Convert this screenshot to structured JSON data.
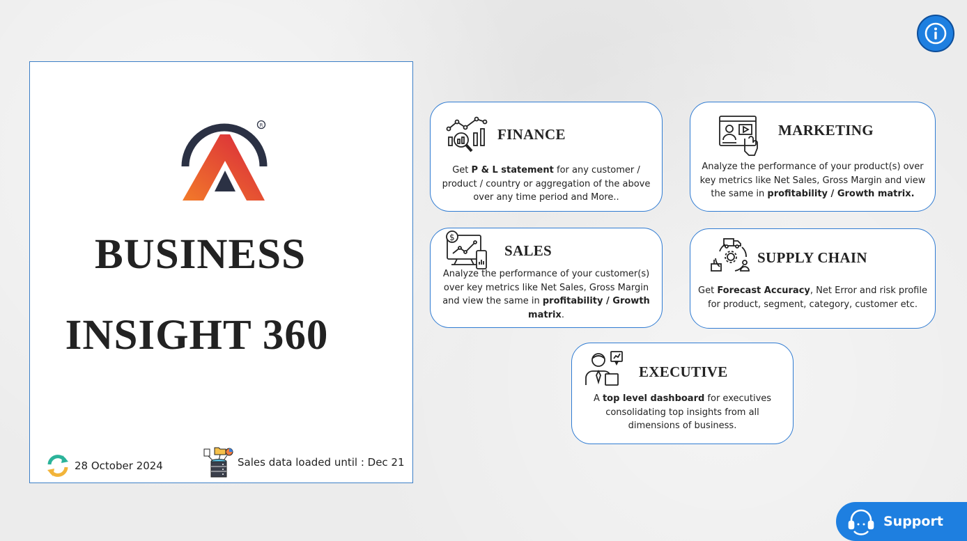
{
  "title_card": {
    "title_line1": "BUSINESS",
    "title_line2": "INSIGHT 360",
    "refresh_date": "28 October 2024",
    "data_loaded": "Sales data loaded until : Dec 21",
    "logo_icon": "brand-a-logo"
  },
  "cards": {
    "finance": {
      "title": "FINANCE",
      "icon": "finance-analytics-icon",
      "desc_pre": "Get ",
      "desc_bold1": "P & L statement",
      "desc_mid": " for any customer / product / country or aggregation of the above over any time period and More..",
      "desc_bold2": "",
      "desc_post": ""
    },
    "marketing": {
      "title": "MARKETING",
      "icon": "marketing-presentation-icon",
      "desc_pre": "Analyze the performance of your product(s) over key metrics like Net Sales, Gross Margin and view the same in ",
      "desc_bold1": "profitability / Growth matrix.",
      "desc_mid": "",
      "desc_bold2": "",
      "desc_post": ""
    },
    "sales": {
      "title": "SALES",
      "icon": "sales-dashboard-icon",
      "desc_pre": "Analyze the performance of your customer(s) over key metrics like Net Sales, Gross Margin and view the same in ",
      "desc_bold1": "profitability / Growth matrix",
      "desc_mid": ".",
      "desc_bold2": "",
      "desc_post": ""
    },
    "supply_chain": {
      "title": "SUPPLY CHAIN",
      "icon": "supply-chain-cycle-icon",
      "desc_pre": "Get ",
      "desc_bold1": "Forecast Accuracy",
      "desc_mid": ", Net Error and risk profile for product, segment, category, customer etc.",
      "desc_bold2": "",
      "desc_post": ""
    },
    "executive": {
      "title": "EXECUTIVE",
      "icon": "executive-person-icon",
      "desc_pre": "A ",
      "desc_bold1": "top level dashboard",
      "desc_mid": " for executives consolidating top insights from all dimensions of business.",
      "desc_bold2": "",
      "desc_post": ""
    }
  },
  "info_button": {
    "icon": "info-icon"
  },
  "support_button": {
    "label": "Support",
    "icon": "support-agent-icon"
  },
  "colors": {
    "accent_blue": "#1e7fe0",
    "card_border": "#2f7bd2",
    "logo_dark": "#2b3144",
    "logo_orange": "#f05a28",
    "logo_red": "#d92b3a"
  }
}
